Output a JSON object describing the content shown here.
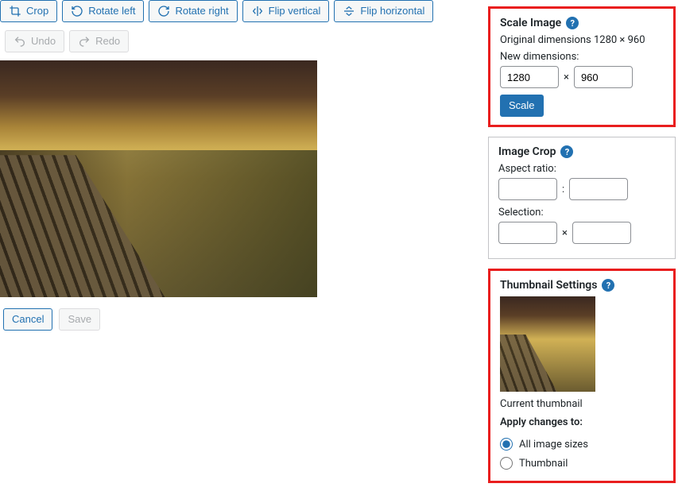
{
  "toolbar": {
    "crop": "Crop",
    "rotate_left": "Rotate left",
    "rotate_right": "Rotate right",
    "flip_vertical": "Flip vertical",
    "flip_horizontal": "Flip horizontal",
    "undo": "Undo",
    "redo": "Redo"
  },
  "actions": {
    "cancel": "Cancel",
    "save": "Save"
  },
  "scale": {
    "title": "Scale Image",
    "original_line": "Original dimensions 1280 × 960",
    "new_label": "New dimensions:",
    "w": "1280",
    "h": "960",
    "sep": "×",
    "button": "Scale"
  },
  "crop": {
    "title": "Image Crop",
    "aspect_label": "Aspect ratio:",
    "aspect_sep": ":",
    "selection_label": "Selection:",
    "selection_sep": "×"
  },
  "thumb": {
    "title": "Thumbnail Settings",
    "current": "Current thumbnail",
    "apply_label": "Apply changes to:",
    "opt_all": "All image sizes",
    "opt_thumb": "Thumbnail"
  }
}
